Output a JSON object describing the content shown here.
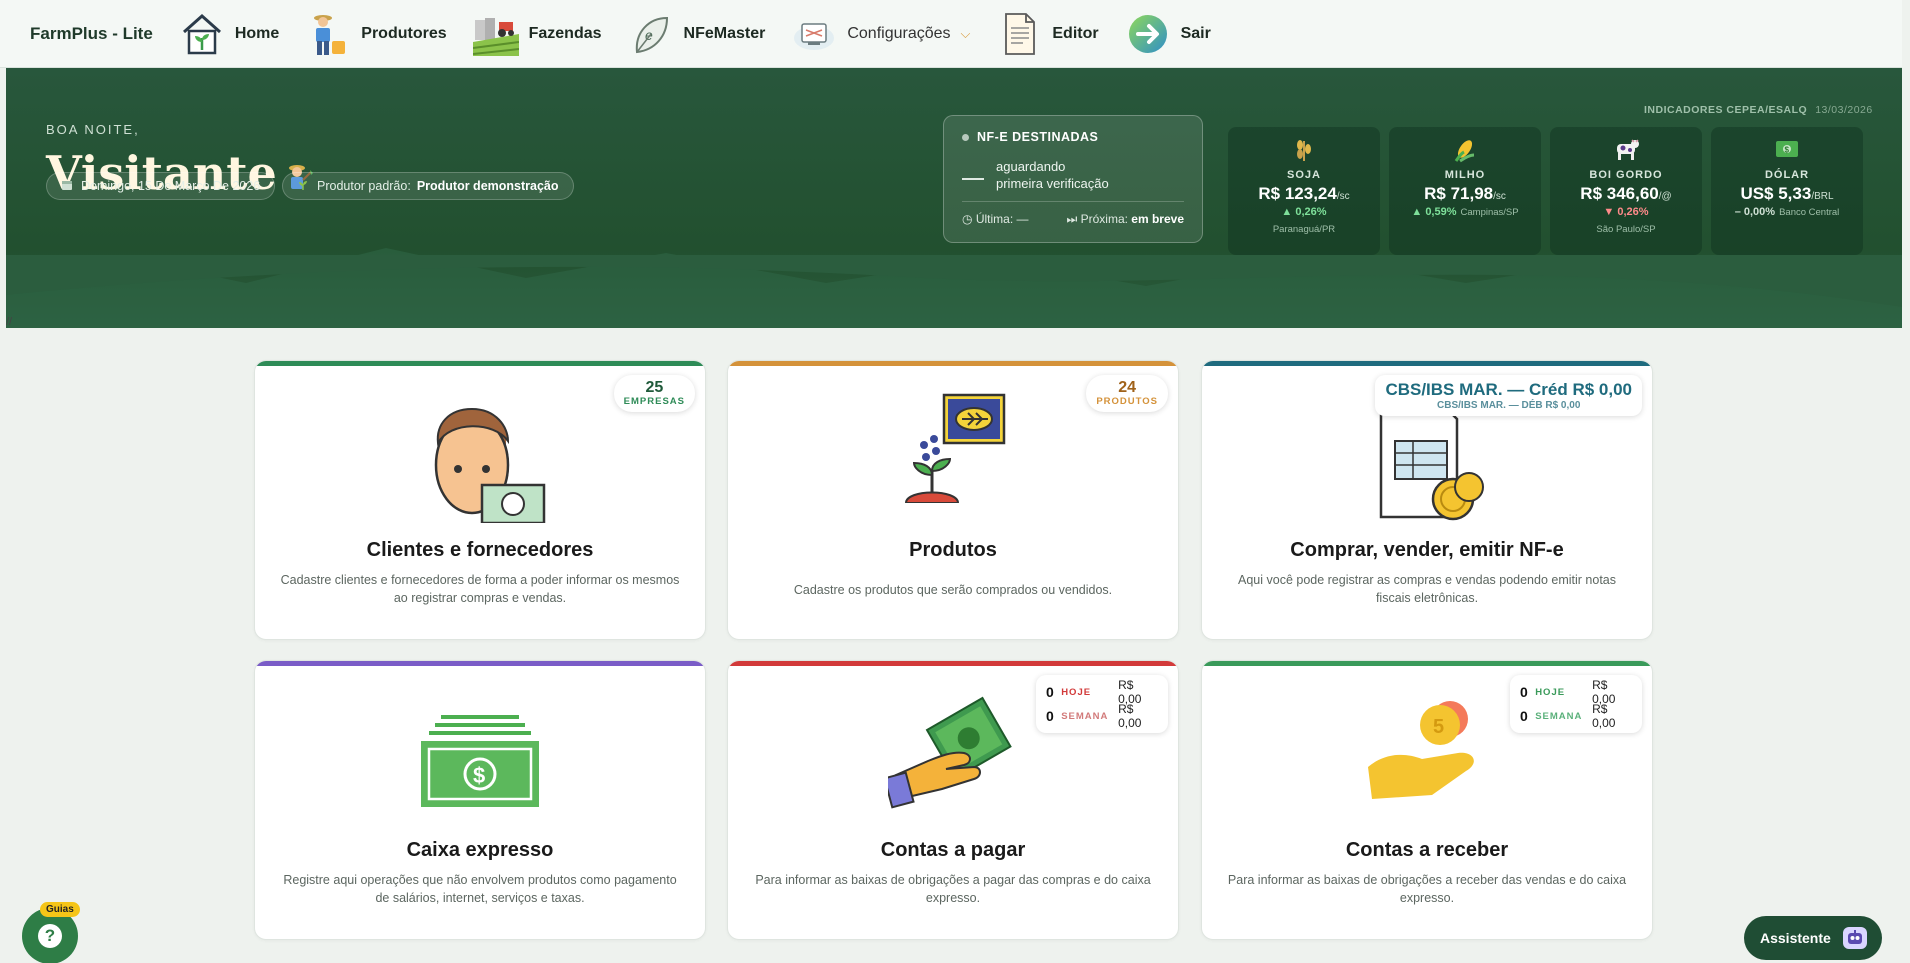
{
  "nav": {
    "brand": "FarmPlus - Lite",
    "items": [
      {
        "label": "Home",
        "icon": "house-plant-icon"
      },
      {
        "label": "Produtores",
        "icon": "farmer-icon"
      },
      {
        "label": "Fazendas",
        "icon": "farm-tractor-icon"
      },
      {
        "label": "NFeMaster",
        "icon": "nfe-leaf-icon"
      },
      {
        "label": "Configurações",
        "icon": "settings-monitor-icon"
      },
      {
        "label": "Editor",
        "icon": "document-icon"
      },
      {
        "label": "Sair",
        "icon": "exit-arrow-icon"
      }
    ]
  },
  "hero": {
    "greeting": "BOA NOITE,",
    "name": "Visitante",
    "date": "Domingo, 15 De Março De 2026",
    "producer_label": "Produtor padrão:",
    "producer_value": "Produtor demonstração"
  },
  "nfe": {
    "title": "NF-E DESTINADAS",
    "status_line1": "aguardando",
    "status_line2": "primeira verificação",
    "last_label": "Última:",
    "last_value": "—",
    "next_label": "Próxima:",
    "next_value": "em breve"
  },
  "indicators": {
    "header": "INDICADORES CEPEA/ESALQ",
    "date": "13/03/2026",
    "items": [
      {
        "name": "SOJA",
        "price": "R$ 123,24",
        "unit": "/sc",
        "var": "▲ 0,26%",
        "trend": "up",
        "extra": "",
        "place": "Paranaguá/PR",
        "icon": "soy-icon"
      },
      {
        "name": "MILHO",
        "price": "R$ 71,98",
        "unit": "/sc",
        "var": "▲ 0,59%",
        "trend": "up",
        "extra": "Campinas/SP",
        "place": "",
        "icon": "corn-icon"
      },
      {
        "name": "BOI GORDO",
        "price": "R$ 346,60",
        "unit": "/@",
        "var": "▼ 0,26%",
        "trend": "down",
        "extra": "",
        "place": "São Paulo/SP",
        "icon": "cow-icon"
      },
      {
        "name": "DÓLAR",
        "price": "US$ 5,33",
        "unit": "/BRL",
        "var": "– 0,00%",
        "trend": "flat",
        "extra": "Banco Central",
        "place": "",
        "icon": "dollar-bill-icon"
      }
    ]
  },
  "misc": {
    "slashes": "//"
  },
  "cards": {
    "clientes": {
      "title": "Clientes e fornecedores",
      "desc": "Cadastre clientes e fornecedores de forma a poder informar os mesmos ao registrar compras e vendas.",
      "badge_num": "25",
      "badge_label": "EMPRESAS"
    },
    "produtos": {
      "title": "Produtos",
      "desc": "Cadastre os produtos que serão comprados ou vendidos.",
      "badge_num": "24",
      "badge_label": "PRODUTOS"
    },
    "nfe": {
      "title": "Comprar, vender, emitir NF-e",
      "desc": "Aqui você pode registrar as compras e vendas podendo emitir notas fiscais eletrônicas.",
      "badge_line1": "CBS/IBS MAR. — Créd R$ 0,00",
      "badge_line2": "CBS/IBS MAR. — DÉB  R$ 0,00"
    },
    "caixa": {
      "title": "Caixa expresso",
      "desc": "Registre aqui operações que não envolvem produtos como pagamento de salários, internet, serviços e taxas."
    },
    "pagar": {
      "title": "Contas a pagar",
      "desc": "Para informar as baixas de obrigações a pagar das compras e do caixa expresso.",
      "hoje_num": "0",
      "hoje_label": "HOJE",
      "hoje_val": "R$ 0,00",
      "semana_num": "0",
      "semana_label": "SEMANA",
      "semana_val": "R$ 0,00"
    },
    "receber": {
      "title": "Contas a receber",
      "desc": "Para informar as baixas de obrigações a receber das vendas e do caixa expresso.",
      "hoje_num": "0",
      "hoje_label": "HOJE",
      "hoje_val": "R$ 0,00",
      "semana_num": "0",
      "semana_label": "SEMANA",
      "semana_val": "R$ 0,00"
    }
  },
  "floating": {
    "guias": "Guias",
    "help": "?",
    "assistente": "Assistente"
  },
  "colors": {
    "hero": "#22502f",
    "clientes": "#2e8b57",
    "produtos": "#d4923a",
    "nfe": "#1f6b7e",
    "caixa": "#7a5cc7",
    "pagar": "#d23a3a",
    "receber": "#3a9a5a"
  }
}
